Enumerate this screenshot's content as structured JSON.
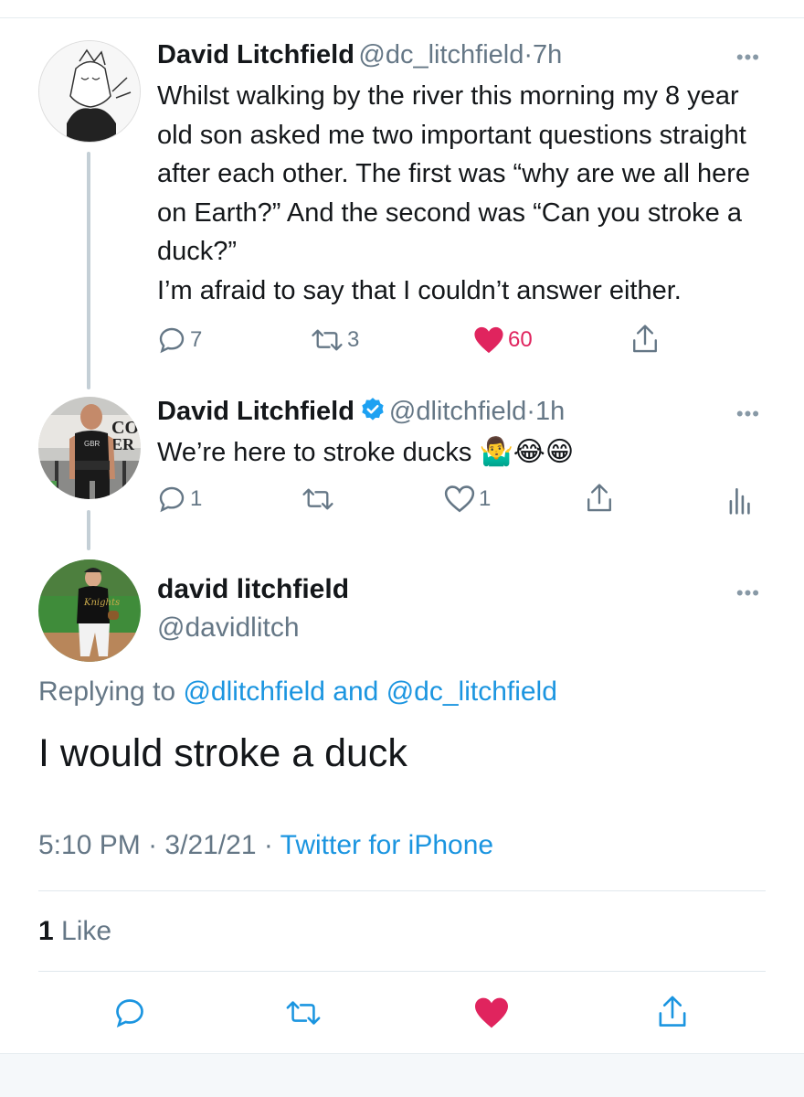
{
  "tweet1": {
    "name": "David Litchfield",
    "handle": "@dc_litchfield",
    "time": "7h",
    "text": "Whilst walking by the river this morning my 8 year old son asked me  two important questions straight after each other. The first was “why are we all here on Earth?” And the second was “Can you stroke a duck?”",
    "text2": "I’m afraid to say that I couldn’t answer either.",
    "replies": "7",
    "retweets": "3",
    "likes": "60"
  },
  "tweet2": {
    "name": "David Litchfield",
    "handle": "@dlitchfield",
    "time": "1h",
    "text": "We’re here to stroke ducks",
    "emojis": "🤷‍♂️😂😁",
    "replies": "1",
    "likes": "1"
  },
  "main": {
    "name": "david litchfield",
    "handle": "@davidlitch",
    "replying_prefix": "Replying to ",
    "replying_user1": "@dlitchfield",
    "replying_and": " and ",
    "replying_user2": "@dc_litchfield",
    "text": "I would stroke a duck",
    "time": "5:10 PM",
    "date": "3/21/21",
    "source": "Twitter for iPhone",
    "like_count": "1",
    "like_label": "Like"
  },
  "separator": "·",
  "more_glyph": "•••",
  "colors": {
    "accent": "#1b95e0",
    "like": "#e0245e",
    "muted": "#657786"
  }
}
